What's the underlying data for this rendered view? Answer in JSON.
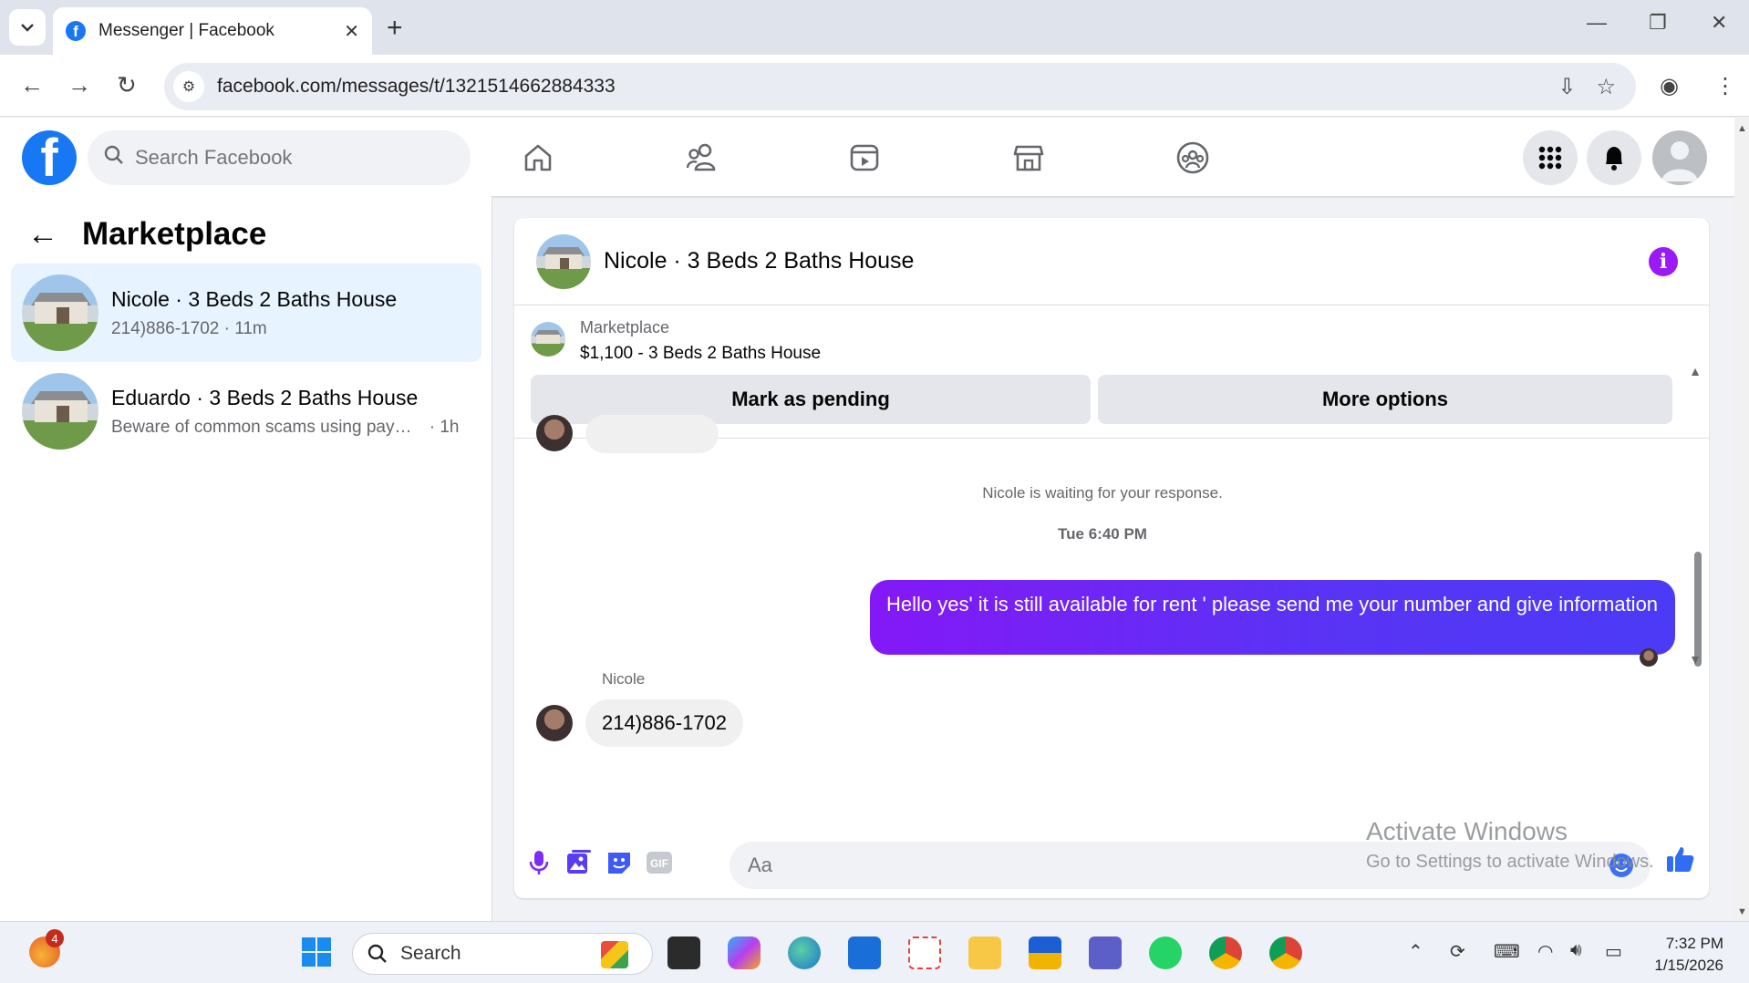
{
  "browser": {
    "tab_title": "Messenger | Facebook",
    "url": "facebook.com/messages/t/1321514662884333",
    "new_tab": "+",
    "tab_close": "✕"
  },
  "fb": {
    "search_placeholder": "Search Facebook",
    "brand_color": "#1877f2"
  },
  "left": {
    "title": "Marketplace",
    "conversations": [
      {
        "name": "Nicole · 3 Beds 2 Baths House",
        "preview": "214)886-1702 · 11m",
        "active": true
      },
      {
        "name": "Eduardo · 3 Beds 2 Baths House",
        "preview": "Beware of common scams using pay…",
        "time": "· 1h",
        "active": false
      }
    ]
  },
  "chat": {
    "title": "Nicole · 3 Beds 2 Baths House",
    "marketplace_label": "Marketplace",
    "listing": "$1,100 - 3 Beds 2 Baths House",
    "mark_pending": "Mark as pending",
    "more_options": "More options",
    "waiting_notice": "Nicole is waiting for your response.",
    "timestamp": "Tue 6:40 PM",
    "outgoing_message": "Hello yes' it is still available for rent ' please send me your number and give information",
    "sender_name": "Nicole",
    "incoming_message": "214)886-1702",
    "composer_placeholder": "Aa",
    "accent_color": "#5a33f5"
  },
  "watermark": {
    "line1": "Activate Windows",
    "line2": "Go to Settings to activate Windows."
  },
  "taskbar": {
    "search_label": "Search",
    "time": "7:32 PM",
    "date": "1/15/2026",
    "notification_count": "4"
  }
}
